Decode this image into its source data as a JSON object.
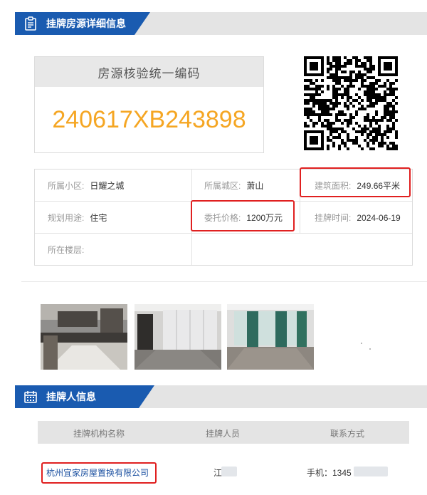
{
  "listing_section": {
    "title": "挂牌房源详细信息",
    "icon": "clipboard-icon"
  },
  "code_card": {
    "title": "房源核验统一编码",
    "code": "240617XB243898"
  },
  "qr": {
    "icon": "qr-code"
  },
  "info": {
    "community_label": "所属小区:",
    "community_value": "日耀之城",
    "district_label": "所属城区:",
    "district_value": "萧山",
    "area_label": "建筑面积:",
    "area_value": "249.66平米",
    "usage_label": "规划用途:",
    "usage_value": "住宅",
    "price_label": "委托价格:",
    "price_value": "1200万元",
    "listing_time_label": "挂牌时间:",
    "listing_time_value": "2024-06-19",
    "floor_label": "所在楼层:",
    "floor_value": ""
  },
  "photos": [
    "kitchen-photo",
    "wardrobe-room-photo",
    "bedroom-photo"
  ],
  "agent_section": {
    "title": "挂牌人信息",
    "icon": "calendar-icon"
  },
  "contact_table": {
    "headers": [
      "挂牌机构名称",
      "挂牌人员",
      "联系方式"
    ],
    "row": {
      "agency": "杭州宜家房屋置换有限公司",
      "person": "江",
      "phone": "手机：1345"
    }
  },
  "colors": {
    "accent_blue": "#1a5bb0",
    "code_orange": "#f5a623",
    "highlight_red": "#e02020",
    "agency_link": "#1a4fa0"
  }
}
